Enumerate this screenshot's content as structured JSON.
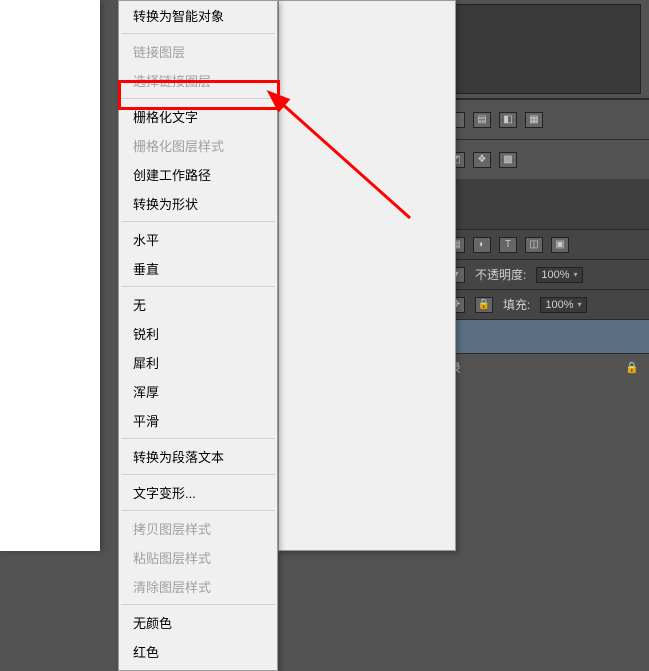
{
  "menu": {
    "convert_smart_object": "转换为智能对象",
    "link_layers": "链接图层",
    "select_linked": "选择链接图层",
    "rasterize_text": "栅格化文字",
    "rasterize_style": "栅格化图层样式",
    "create_work_path": "创建工作路径",
    "convert_to_shape": "转换为形状",
    "horizontal": "水平",
    "vertical": "垂直",
    "none": "无",
    "sharp": "锐利",
    "crisp": "犀利",
    "strong": "浑厚",
    "smooth": "平滑",
    "convert_paragraph": "转换为段落文本",
    "warp_text": "文字变形...",
    "copy_style": "拷贝图层样式",
    "paste_style": "粘贴图层样式",
    "clear_style": "清除图层样式",
    "no_color": "无颜色",
    "red": "红色"
  },
  "panels": {
    "opacity_label": "不透明度:",
    "opacity_value": "100%",
    "fill_label": "填充:",
    "fill_value": "100%",
    "layer_group": "录"
  }
}
